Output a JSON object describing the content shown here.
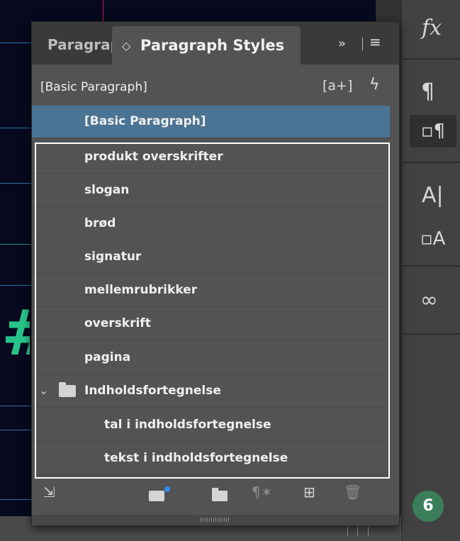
{
  "panel": {
    "tabs": [
      {
        "label": "Paragraph"
      },
      {
        "label": "Paragraph Styles",
        "active": true
      }
    ],
    "collapse_glyph": "»",
    "menu_glyph": "≡",
    "current_style": "[Basic Paragraph]",
    "new_override_icon": "[a+]",
    "quick_apply_icon": "ϟ",
    "styles": [
      {
        "label": "[Basic Paragraph]",
        "selected": true
      },
      {
        "label": "produkt overskrifter"
      },
      {
        "label": "slogan"
      },
      {
        "label": "brød"
      },
      {
        "label": "signatur"
      },
      {
        "label": "mellemrubrikker"
      },
      {
        "label": "overskrift"
      },
      {
        "label": "pagina"
      },
      {
        "label": "Indholdsfortegnelse",
        "type": "group",
        "expanded": true
      },
      {
        "label": "tal i indholdsfortegnelse",
        "indent": 1
      },
      {
        "label": "tekst i indholdsfortegnelse",
        "indent": 1
      }
    ],
    "footer_icons": [
      "load-styles-icon",
      "new-style-group-from-quick-apply-icon",
      "new-style-group-icon",
      "clear-overrides-icon",
      "create-new-style-icon",
      "delete-style-icon"
    ]
  },
  "dock": {
    "badge": "6",
    "icons": [
      "fx-icon",
      "paragraph-icon",
      "paragraph-styles-icon",
      "character-icon",
      "character-styles-icon",
      "links-icon"
    ]
  },
  "colors": {
    "selection": "#4a7394",
    "badge": "#3b7f5a",
    "canvas": "#070a1e"
  }
}
